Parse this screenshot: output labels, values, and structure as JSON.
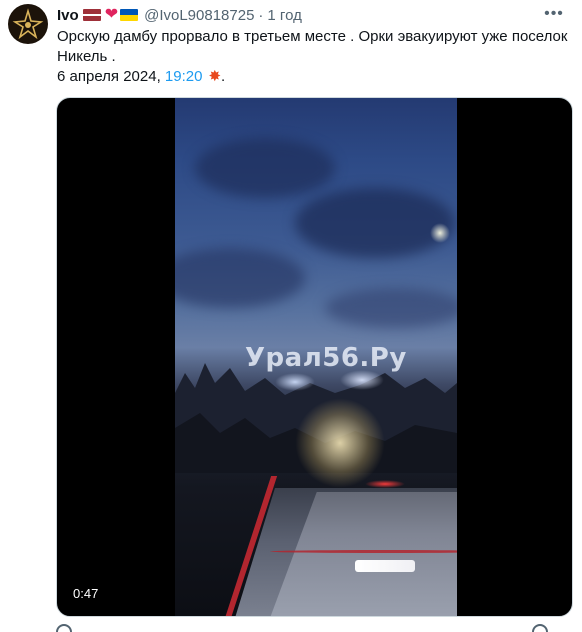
{
  "author": {
    "display_name": "Ivo",
    "handle": "@IvoL90818725",
    "time_ago": "1 год",
    "badges": [
      "flag-latvia-icon",
      "red-heart-icon",
      "flag-ukraine-icon"
    ]
  },
  "tweet": {
    "text": "Орскую дамбу прорвало в третьем месте . Орки эвакуируют уже поселок Никель .",
    "date_prefix": "6 апреля 2024, ",
    "time": "19:20",
    "emoji": "collision-icon",
    "suffix": "."
  },
  "media": {
    "type": "video",
    "watermark": "Урал56.Ру",
    "duration": "0:47"
  },
  "colors": {
    "text": "#0f1419",
    "muted": "#536471",
    "link": "#1d9bf0",
    "heart": "#e0245e"
  }
}
